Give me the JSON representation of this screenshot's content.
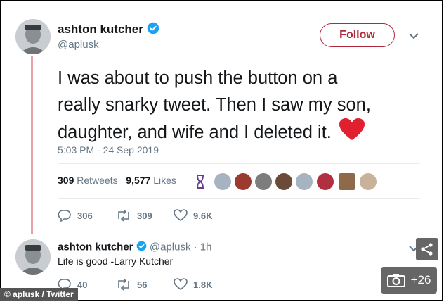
{
  "tweet": {
    "author_name": "ashton kutcher",
    "author_handle": "@aplusk",
    "follow_label": "Follow",
    "text_lines": [
      "I was about to push the button on a",
      "really snarky tweet. Then I saw my son,",
      "daughter, and wife and I deleted it."
    ],
    "heart_emoji": "❤",
    "timestamp": "5:03 PM - 24 Sep 2019",
    "retweets_count": "309",
    "retweets_label": "Retweets",
    "likes_count": "9,577",
    "likes_label": "Likes",
    "actions": {
      "replies": "306",
      "retweets": "309",
      "likes": "9.6K"
    }
  },
  "reply": {
    "author_name": "ashton kutcher",
    "author_handle": "@aplusk",
    "time_ago": "· 1h",
    "text": "Life is good -Larry Kutcher",
    "actions": {
      "replies": "40",
      "retweets": "56",
      "likes": "1.8K"
    }
  },
  "overlay": {
    "credit": "© aplusk / Twitter",
    "gallery_count": "+26"
  },
  "colors": {
    "brand_red": "#b0283b",
    "verified_blue": "#1da1f2",
    "muted_gray": "#657786",
    "thread_line": "#e6a0a6"
  }
}
